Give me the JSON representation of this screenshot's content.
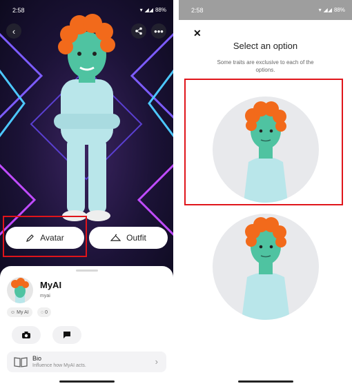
{
  "left": {
    "status": {
      "time": "2:58",
      "battery": "88%"
    },
    "icons": {
      "back": "chevron-left",
      "share": "share",
      "more": "more-horizontal"
    },
    "avatar_button_label": "Avatar",
    "outfit_button_label": "Outfit",
    "profile": {
      "name": "MyAI",
      "username": "myai",
      "badge_label": "My AI",
      "friend_count": "0"
    },
    "bio": {
      "title": "Bio",
      "subtitle": "Influence how MyAI acts."
    },
    "colors": {
      "highlight": "#e0141a",
      "skin": "#4fc3a1",
      "hair": "#f26a1b",
      "outfit": "#b9e6ea"
    }
  },
  "right": {
    "status": {
      "time": "2:58",
      "battery": "88%"
    },
    "close_icon": "close",
    "title": "Select an option",
    "subtitle": "Some traits are exclusive to each of the options."
  }
}
